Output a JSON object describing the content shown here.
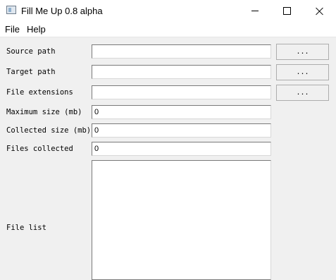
{
  "window": {
    "title": "Fill Me Up 0.8 alpha"
  },
  "menu": {
    "items": [
      "File",
      "Help"
    ]
  },
  "form": {
    "source_label": "Source path",
    "source_value": "",
    "target_label": "Target path",
    "target_value": "",
    "extensions_label": "File extensions",
    "extensions_value": "",
    "max_size_label": "Maximum size (mb)",
    "max_size_value": "0",
    "collected_size_label": "Collected size (mb)",
    "collected_size_value": "0",
    "files_collected_label": "Files collected",
    "files_collected_value": "0",
    "file_list_label": "File list",
    "browse_label": "..."
  },
  "icons": {
    "app": "app-window-icon",
    "minimize": "minimize-icon",
    "maximize": "maximize-icon",
    "close": "close-icon"
  }
}
